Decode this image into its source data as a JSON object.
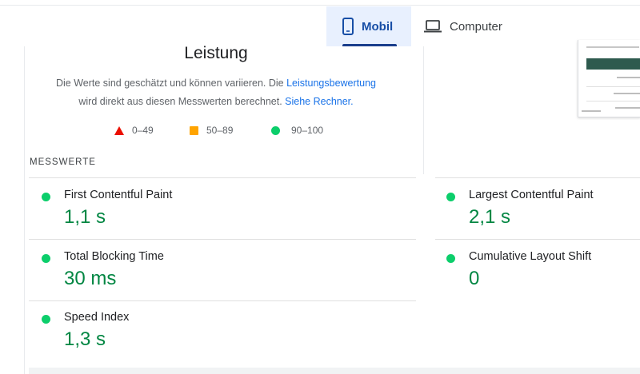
{
  "tabs": [
    {
      "label": "Mobil",
      "icon": "smartphone-icon",
      "selected": true
    },
    {
      "label": "Computer",
      "icon": "laptop-icon",
      "selected": false
    }
  ],
  "performance": {
    "title": "Leistung",
    "description_part1": "Die Werte sind geschätzt und können variieren. Die ",
    "link_score": "Leistungsbewertung",
    "description_part2": "wird direkt aus diesen Messwerten berechnet. ",
    "link_calculator": "Siehe Rechner."
  },
  "legend": [
    {
      "range": "0–49",
      "shape": "triangle",
      "color": "#eb0f00"
    },
    {
      "range": "50–89",
      "shape": "square",
      "color": "#ffa400"
    },
    {
      "range": "90–100",
      "shape": "circle",
      "color": "#0cce6b"
    }
  ],
  "metrics_section": {
    "title": "MESSWERTE",
    "items": [
      {
        "label": "First Contentful Paint",
        "value": "1,1 s"
      },
      {
        "label": "Largest Contentful Paint",
        "value": "2,1 s"
      },
      {
        "label": "Total Blocking Time",
        "value": "30 ms"
      },
      {
        "label": "Cumulative Layout Shift",
        "value": "0"
      },
      {
        "label": "Speed Index",
        "value": "1,3 s"
      }
    ]
  },
  "colors": {
    "pass": "#0cce6b",
    "pass_text": "#018642",
    "link": "#1a73e8",
    "tab_selected_bg": "#e8f0fe"
  }
}
